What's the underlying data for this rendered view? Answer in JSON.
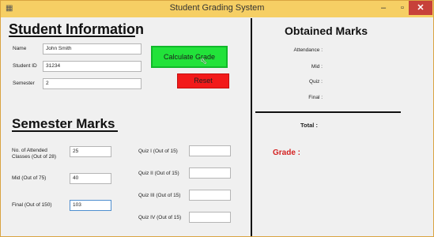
{
  "window": {
    "title": "Student Grading System",
    "controls": {
      "minimize": "–",
      "maximize": "▫",
      "close": "✕"
    }
  },
  "student_info": {
    "heading": "Student Information",
    "name_label": "Name",
    "name_value": "John Smith",
    "id_label": "Student ID",
    "id_value": "31234",
    "semester_label": "Semester",
    "semester_value": "2"
  },
  "buttons": {
    "calculate_label": "Calculate Grade",
    "reset_label": "Reset"
  },
  "semester_marks": {
    "heading": "Semester Marks",
    "attended_label_line1": "No. of Attended",
    "attended_label_line2": "Classes (Out of 28)",
    "attended_value": "25",
    "mid_label": "Mid (Out of 75)",
    "mid_value": "40",
    "final_label": "Final (Out of 150)",
    "final_value": "103",
    "quiz1_label": "Quiz I (Out of 15)",
    "quiz1_value": "",
    "quiz2_label": "Quiz II (Out of 15)",
    "quiz2_value": "",
    "quiz3_label": "Quiz III (Out of 15)",
    "quiz3_value": "",
    "quiz4_label": "Quiz IV (Out of 15)",
    "quiz4_value": ""
  },
  "obtained": {
    "heading": "Obtained Marks",
    "attendance_label": "Attendance :",
    "mid_label": "Mid :",
    "quiz_label": "Quiz :",
    "final_label": "Final :",
    "total_label": "Total :",
    "grade_label": "Grade :"
  },
  "colors": {
    "titlebar": "#f6cf64",
    "calculate_button": "#22e23a",
    "reset_button": "#f21a1a",
    "grade_text": "#d42222"
  }
}
